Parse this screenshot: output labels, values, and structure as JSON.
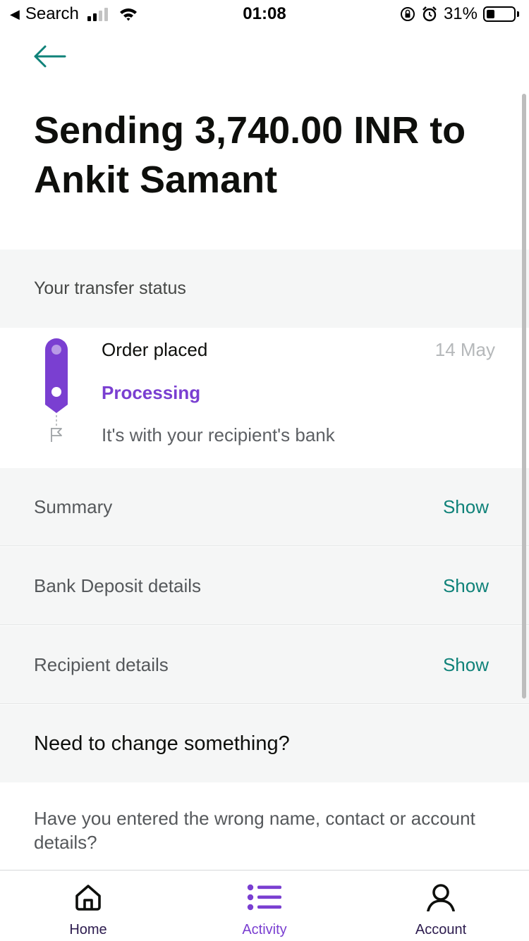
{
  "status_bar": {
    "back_app": "Search",
    "time": "01:08",
    "battery_percent": "31%",
    "battery_level": 0.31,
    "signal_bars_active": 2,
    "signal_bars_total": 4
  },
  "header": {
    "back_icon": "arrow-left-icon",
    "title": "Sending 3,740.00 INR to Ankit Samant"
  },
  "transfer_status": {
    "heading": "Your transfer status",
    "steps": [
      {
        "label": "Order placed",
        "date": "14 May",
        "state": "done"
      },
      {
        "label": "Processing",
        "state": "current"
      },
      {
        "label": "It's with your recipient's bank",
        "state": "pending"
      }
    ]
  },
  "sections": [
    {
      "label": "Summary",
      "action": "Show"
    },
    {
      "label": "Bank Deposit details",
      "action": "Show"
    },
    {
      "label": "Recipient details",
      "action": "Show"
    }
  ],
  "change": {
    "heading": "Need to change something?",
    "text": "Have you entered the wrong name, contact or account details?"
  },
  "tabbar": {
    "tabs": [
      {
        "label": "Home",
        "icon": "home-icon",
        "active": false
      },
      {
        "label": "Activity",
        "icon": "list-icon",
        "active": true
      },
      {
        "label": "Account",
        "icon": "user-icon",
        "active": false
      }
    ]
  },
  "colors": {
    "accent_purple": "#7a3fd1",
    "link_teal": "#0f8279",
    "section_bg": "#f5f6f6"
  }
}
